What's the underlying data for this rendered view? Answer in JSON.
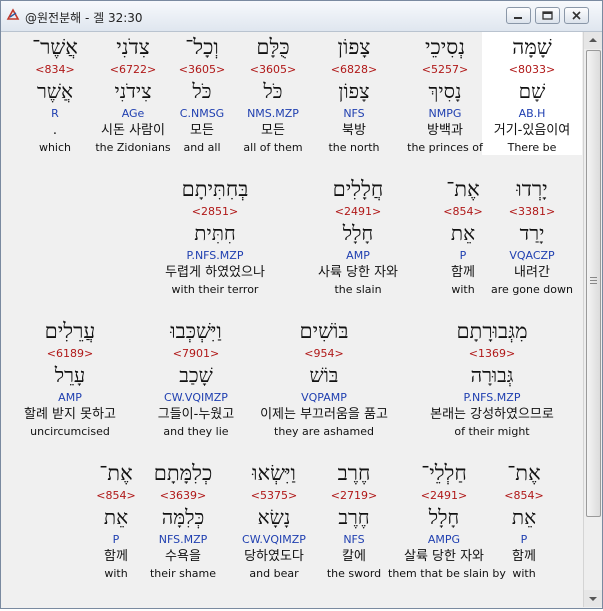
{
  "window": {
    "title": "@원전분해 - 겔 32:30",
    "icon": "app-logo-icon"
  },
  "rows": [
    [
      {
        "heb": "שָׁמָּה",
        "num": "<8033>",
        "lemma": "שָׁם",
        "parse": "AB.H",
        "kor": "거기-있음이여",
        "eng": "There be",
        "hl": true
      },
      {
        "heb": "נְסִיכֵי",
        "num": "<5257>",
        "lemma": "נָסִיךְ",
        "parse": "NMPG",
        "kor": "방백과",
        "eng": "the princes of"
      },
      {
        "heb": "צָפוֹן",
        "num": "<6828>",
        "lemma": "צָפוֹן",
        "parse": "NFS",
        "kor": "북방",
        "eng": "the north"
      },
      {
        "heb": "כֻּלָּם",
        "num": "<3605>",
        "lemma": "כֹּל",
        "parse": "NMS.MZP",
        "kor": "모든",
        "eng": "all of them"
      },
      {
        "heb": "וְכָל־",
        "num": "<3605>",
        "lemma": "כֹּל",
        "parse": "C.NMSG",
        "kor": "모든",
        "eng": "and all"
      },
      {
        "heb": "צִדֹנִי",
        "num": "<6722>",
        "lemma": "צִידֹנִי",
        "parse": "AGe",
        "kor": "시돈 사람이",
        "eng": "the Zidonians"
      },
      {
        "heb": "אֲשֶׁר־",
        "num": "<834>",
        "lemma": "אֲשֶׁר",
        "parse": "R",
        "kor": ".",
        "eng": "which"
      }
    ],
    [
      {
        "heb": "יָרְדוּ",
        "num": "<3381>",
        "lemma": "יָרַד",
        "parse": "VQACZP",
        "kor": "내려간",
        "eng": "are gone down"
      },
      {
        "heb": "אֶת־",
        "num": "<854>",
        "lemma": "אֵת",
        "parse": "P",
        "kor": "함께",
        "eng": "with"
      },
      {
        "heb": "חֲלָלִים",
        "num": "<2491>",
        "lemma": "חָלָל",
        "parse": "AMP",
        "kor": "사륙 당한 자와",
        "eng": "the slain"
      },
      {
        "heb": "בְּחִתִּיתָם",
        "num": "<2851>",
        "lemma": "חִתִּית",
        "parse": "P.NFS.MZP",
        "kor": "두렵게 하였었으나",
        "eng": "with their terror"
      }
    ],
    [
      {
        "heb": "מִגְּבוּרָתָם",
        "num": "<1369>",
        "lemma": "גְּבוּרָה",
        "parse": "P.NFS.MZP",
        "kor": "본래는 강성하였으므로",
        "eng": "of their might"
      },
      {
        "heb": "בּוֹשִׁים",
        "num": "<954>",
        "lemma": "בּוֹשׁ",
        "parse": "VQPAMP",
        "kor": "이제는 부끄러움을 품고",
        "eng": "they are ashamed"
      },
      {
        "heb": "וַיִּשְׁכְּבוּ",
        "num": "<7901>",
        "lemma": "שָׁכַב",
        "parse": "CW.VQIMZP",
        "kor": "그들이-누웠고",
        "eng": "and they lie"
      },
      {
        "heb": "עֲרֵלִים",
        "num": "<6189>",
        "lemma": "עָרֵל",
        "parse": "AMP",
        "kor": "할례 받지 못하고",
        "eng": "uncircumcised"
      }
    ],
    [
      {
        "heb": "אֶת־",
        "num": "<854>",
        "lemma": "אֵת",
        "parse": "P",
        "kor": "함께",
        "eng": "with"
      },
      {
        "heb": "חַלְלֵי־",
        "num": "<2491>",
        "lemma": "חָלָל",
        "parse": "AMPG",
        "kor": "살륙 당한 자와",
        "eng": "them that be slain by"
      },
      {
        "heb": "חֶרֶב",
        "num": "<2719>",
        "lemma": "חֶרֶב",
        "parse": "NFS",
        "kor": "칼에",
        "eng": "the sword"
      },
      {
        "heb": "וַיִּשְׂאוּ",
        "num": "<5375>",
        "lemma": "נָשָׂא",
        "parse": "CW.VQIMZP",
        "kor": "당하였도다",
        "eng": "and bear"
      },
      {
        "heb": "כְלִמָּתָם",
        "num": "<3639>",
        "lemma": "כְּלִמָּה",
        "parse": "NFS.MZP",
        "kor": "수욕을",
        "eng": "their shame"
      },
      {
        "heb": "אֶת־",
        "num": "<854>",
        "lemma": "אֵת",
        "parse": "P",
        "kor": "함께",
        "eng": "with"
      }
    ]
  ]
}
